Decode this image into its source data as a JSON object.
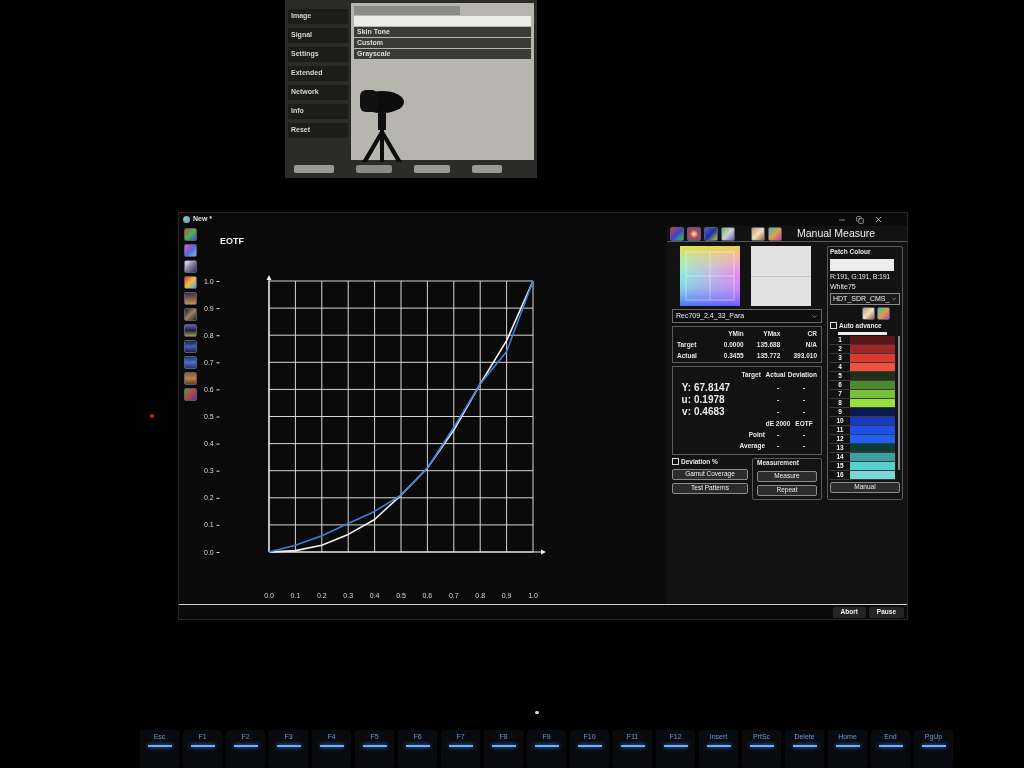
{
  "projector": {
    "menu": [
      {
        "label": "Image"
      },
      {
        "label": "Signal"
      },
      {
        "label": "Settings"
      },
      {
        "label": "Extended"
      },
      {
        "label": "Network"
      },
      {
        "label": "Info"
      },
      {
        "label": "Reset"
      }
    ],
    "options": [
      {
        "label": "Skin Tone"
      },
      {
        "label": "Custom"
      },
      {
        "label": "Grayscale"
      }
    ]
  },
  "app": {
    "title": "New *",
    "chart": {
      "chart_data": {
        "type": "line",
        "title": "EOTF",
        "grid": true,
        "x": [
          0,
          0.1,
          0.2,
          0.3,
          0.4,
          0.5,
          0.6,
          0.7,
          0.8,
          0.9,
          1.0
        ],
        "series": [
          {
            "color": "#f2f2f2",
            "values": [
              0,
              0.005,
              0.025,
              0.065,
              0.12,
              0.21,
              0.31,
              0.45,
              0.62,
              0.78,
              1.0
            ]
          },
          {
            "color": "#3f7fdc",
            "values": [
              0,
              0.025,
              0.06,
              0.105,
              0.15,
              0.21,
              0.31,
              0.46,
              0.62,
              0.74,
              1.0
            ]
          }
        ],
        "xlim": [
          0,
          1
        ],
        "ylim": [
          0,
          1
        ],
        "xticks": [
          {
            "value": 0,
            "label": "0.0"
          },
          {
            "value": 0.1,
            "label": "0.1"
          },
          {
            "value": 0.2,
            "label": "0.2"
          },
          {
            "value": 0.3,
            "label": "0.3"
          },
          {
            "value": 0.4,
            "label": "0.4"
          },
          {
            "value": 0.5,
            "label": "0.5"
          },
          {
            "value": 0.6,
            "label": "0.6"
          },
          {
            "value": 0.7,
            "label": "0.7"
          },
          {
            "value": 0.8,
            "label": "0.8"
          },
          {
            "value": 0.9,
            "label": "0.9"
          },
          {
            "value": 1,
            "label": "1.0"
          }
        ],
        "yticks": [
          {
            "value": 0,
            "label": "0.0"
          },
          {
            "value": 0.1,
            "label": "0.1"
          },
          {
            "value": 0.2,
            "label": "0.2"
          },
          {
            "value": 0.3,
            "label": "0.3"
          },
          {
            "value": 0.4,
            "label": "0.4"
          },
          {
            "value": 0.5,
            "label": "0.5"
          },
          {
            "value": 0.6,
            "label": "0.6"
          },
          {
            "value": 0.7,
            "label": "0.7"
          },
          {
            "value": 0.8,
            "label": "0.8"
          },
          {
            "value": 0.9,
            "label": "0.9"
          },
          {
            "value": 1,
            "label": "1.0"
          }
        ]
      }
    },
    "panel": {
      "title": "Manual Measure",
      "profile": "Rec709_2.4_33_Para",
      "luminance": {
        "columns": [
          "YMin",
          "YMax",
          "CR"
        ],
        "rows": [
          {
            "label": "Target",
            "values": [
              "0.0000",
              "135.688",
              "N/A"
            ]
          },
          {
            "label": "Actual",
            "values": [
              "0.3455",
              "135.772",
              "393.010"
            ]
          }
        ]
      },
      "readings": {
        "columns": [
          "Target",
          "Actual",
          "Deviation"
        ],
        "rows": [
          {
            "label": "Y:",
            "target": "67.8147",
            "actual": "-",
            "deviation": "-"
          },
          {
            "label": "u:",
            "target": "0.1978",
            "actual": "-",
            "deviation": "-"
          },
          {
            "label": "v:",
            "target": "0.4683",
            "actual": "-",
            "deviation": "-"
          }
        ],
        "de_columns": [
          "dE 2000",
          "EOTF"
        ],
        "de_rows": [
          {
            "label": "Point",
            "values": [
              "-",
              "-"
            ]
          },
          {
            "label": "Average",
            "values": [
              "-",
              "-"
            ]
          }
        ]
      },
      "deviation_percent": {
        "label": "Deviation %",
        "checked": false
      },
      "buttons": [
        "Gamut Coverage",
        "Test Patterns"
      ],
      "measurement": {
        "title": "Measurement",
        "buttons": [
          "Measure",
          "Repeat"
        ]
      }
    },
    "patch_colour": {
      "title": "Patch Colour",
      "rgb": "R:191, G:191, B:191",
      "name": "White75",
      "sequence": "HDT_SDR_CMS_",
      "auto_advance": {
        "label": "Auto advance",
        "checked": false
      },
      "patches": [
        {
          "label": "1",
          "color": "#5a1515"
        },
        {
          "label": "2",
          "color": "#a0262a"
        },
        {
          "label": "3",
          "color": "#d83a30"
        },
        {
          "label": "4",
          "color": "#f05040"
        },
        {
          "label": "5",
          "color": "#1e3018"
        },
        {
          "label": "6",
          "color": "#4c8a2a"
        },
        {
          "label": "7",
          "color": "#78c038"
        },
        {
          "label": "8",
          "color": "#98e040"
        },
        {
          "label": "9",
          "color": "#0c1850"
        },
        {
          "label": "10",
          "color": "#1838c0"
        },
        {
          "label": "11",
          "color": "#1c50e8"
        },
        {
          "label": "12",
          "color": "#2060f8"
        },
        {
          "label": "13",
          "color": "#0e3a3a"
        },
        {
          "label": "14",
          "color": "#3c9e9e"
        },
        {
          "label": "15",
          "color": "#58d0d0"
        },
        {
          "label": "16",
          "color": "#7ad8d8"
        }
      ],
      "button": "Manual"
    },
    "footer_buttons": [
      "Abort",
      "Pause"
    ]
  },
  "keyboard": {
    "keys": [
      "Esc",
      "F1",
      "F2",
      "F3",
      "F4",
      "F5",
      "F6",
      "F7",
      "F8",
      "F9",
      "F10",
      "F11",
      "F12",
      "Insert",
      "PrtSc",
      "Delete",
      "Home",
      "End",
      "PgUp"
    ]
  }
}
